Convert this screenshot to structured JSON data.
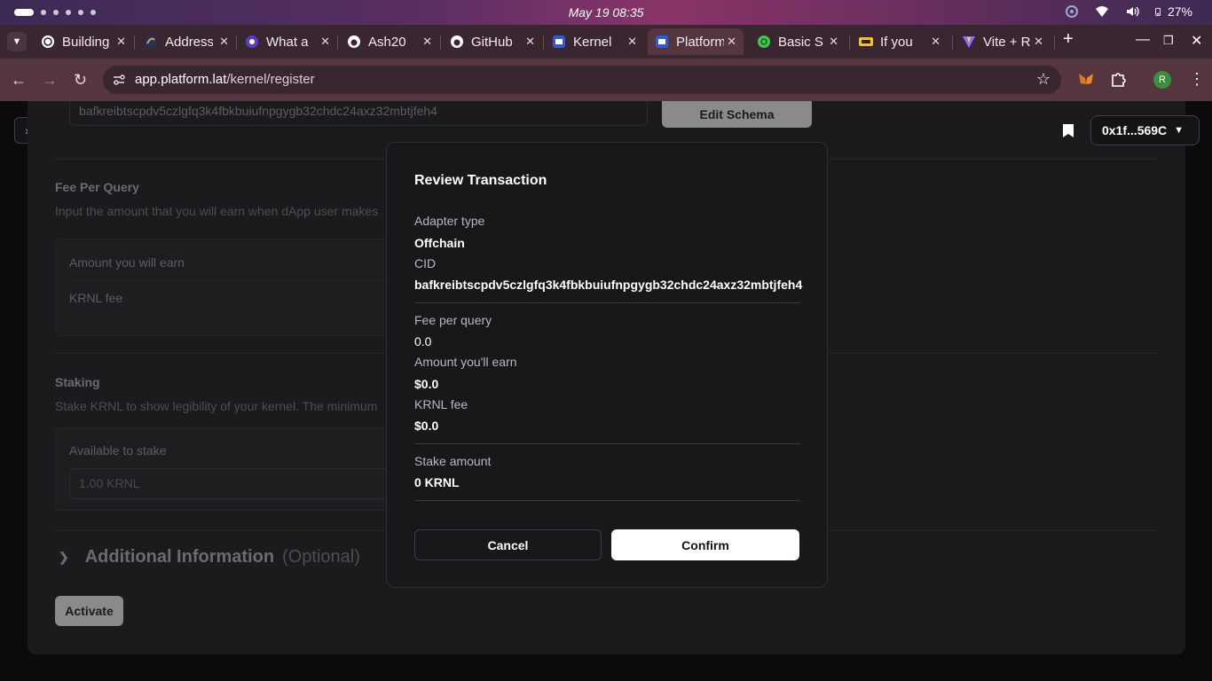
{
  "os": {
    "clock": "May 19  08:35",
    "battery": "27%"
  },
  "browser": {
    "tabs": [
      {
        "title": "Building",
        "icon": "openai-icon"
      },
      {
        "title": "Address",
        "icon": "etherscan-icon"
      },
      {
        "title": "What a",
        "icon": "chat-icon"
      },
      {
        "title": "Ash20",
        "icon": "github-icon"
      },
      {
        "title": "GitHub",
        "icon": "github-icon"
      },
      {
        "title": "Kernel",
        "icon": "krnl-icon"
      },
      {
        "title": "Platform",
        "icon": "krnl-icon"
      },
      {
        "title": "Basic S",
        "icon": "globe-icon"
      },
      {
        "title": "If you",
        "icon": "imdb-icon"
      },
      {
        "title": "Vite + R",
        "icon": "vite-icon"
      }
    ],
    "active_tab_index": 6,
    "url_host": "app.platform.lat",
    "url_path": "/kernel/register",
    "profile_initial": "R"
  },
  "page": {
    "cid_value": "bafkreibtscpdv5czlgfq3k4fbkbuiufnpgygb32chdc24axz32mbtjfeh4",
    "edit_schema_label": "Edit Schema",
    "wallet_label": "0x1f...569C",
    "fee_section": {
      "title": "Fee Per Query",
      "description": "Input the amount that you will earn when dApp user makes",
      "amount_label": "Amount you will earn",
      "krnl_fee_label": "KRNL fee"
    },
    "staking_section": {
      "title": "Staking",
      "description": "Stake KRNL to show legibility of your kernel. The minimum",
      "available_label": "Available to stake",
      "available_value": "1.00 KRNL"
    },
    "additional": {
      "title": "Additional Information",
      "optional": "(Optional)"
    },
    "activate_label": "Activate"
  },
  "modal": {
    "title": "Review Transaction",
    "adapter_type_label": "Adapter type",
    "adapter_type_value": "Offchain",
    "cid_label": "CID",
    "cid_value": "bafkreibtscpdv5czlgfq3k4fbkbuiufnpgygb32chdc24axz32mbtjfeh4",
    "fee_label": "Fee per query",
    "fee_value": "0.0",
    "earn_label": "Amount you'll earn",
    "earn_value": "$0.0",
    "krnl_fee_label": "KRNL fee",
    "krnl_fee_value": "$0.0",
    "stake_label": "Stake amount",
    "stake_value": "0 KRNL",
    "cancel_label": "Cancel",
    "confirm_label": "Confirm"
  },
  "colors": {
    "accent": "#ffffff",
    "card_bg": "#1b1b1e",
    "modal_bg": "#18181b",
    "browser_chrome": "#55363f"
  }
}
